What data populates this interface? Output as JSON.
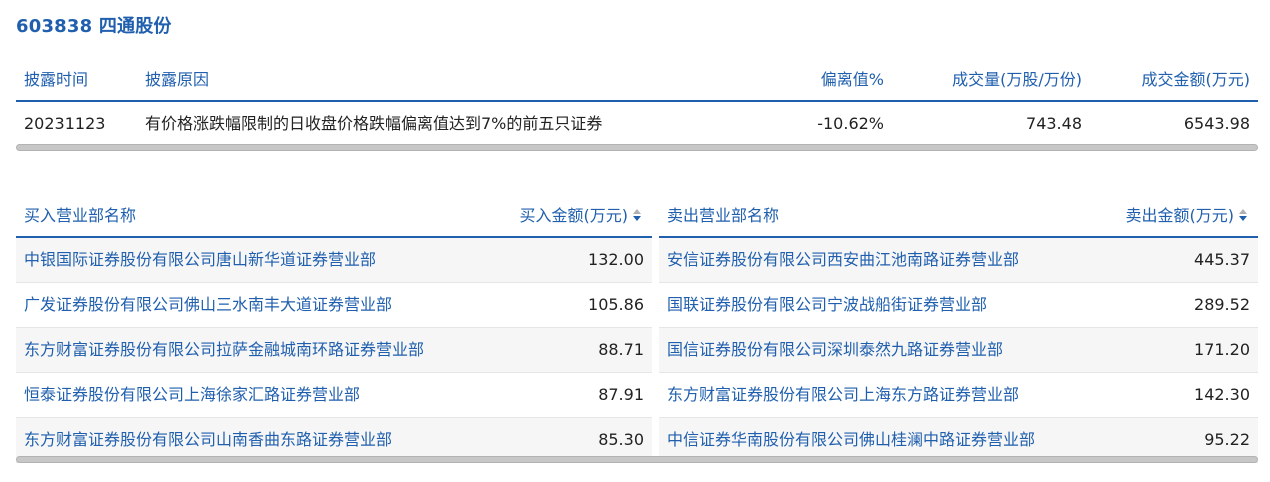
{
  "title": "603838 四通股份",
  "disclosure": {
    "headers": [
      "披露时间",
      "披露原因",
      "偏离值%",
      "成交量(万股/万份)",
      "成交金额(万元)"
    ],
    "row": {
      "date": "20231123",
      "reason": "有价格涨跌幅限制的日收盘价格跌幅偏离值达到7%的前五只证券",
      "deviation": "-10.62%",
      "volume": "743.48",
      "amount": "6543.98"
    }
  },
  "buy": {
    "header_name": "买入营业部名称",
    "header_amount": "买入金额(万元)",
    "rows": [
      {
        "name": "中银国际证券股份有限公司唐山新华道证券营业部",
        "amount": "132.00"
      },
      {
        "name": "广发证券股份有限公司佛山三水南丰大道证券营业部",
        "amount": "105.86"
      },
      {
        "name": "东方财富证券股份有限公司拉萨金融城南环路证券营业部",
        "amount": "88.71"
      },
      {
        "name": "恒泰证券股份有限公司上海徐家汇路证券营业部",
        "amount": "87.91"
      },
      {
        "name": "东方财富证券股份有限公司山南香曲东路证券营业部",
        "amount": "85.30"
      }
    ]
  },
  "sell": {
    "header_name": "卖出营业部名称",
    "header_amount": "卖出金额(万元)",
    "rows": [
      {
        "name": "安信证券股份有限公司西安曲江池南路证券营业部",
        "amount": "445.37"
      },
      {
        "name": "国联证券股份有限公司宁波战船街证券营业部",
        "amount": "289.52"
      },
      {
        "name": "国信证券股份有限公司深圳泰然九路证券营业部",
        "amount": "171.20"
      },
      {
        "name": "东方财富证券股份有限公司上海东方路证券营业部",
        "amount": "142.30"
      },
      {
        "name": "中信证券华南股份有限公司佛山桂澜中路证券营业部",
        "amount": "95.22"
      }
    ]
  },
  "colors": {
    "accent": "#1f5fae",
    "sort_down": "#1f5fae",
    "sort_up": "#b0b0b0"
  }
}
